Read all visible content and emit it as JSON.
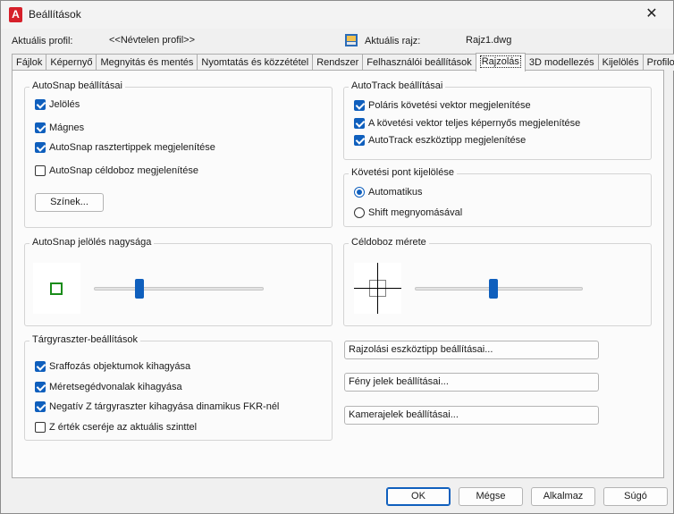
{
  "window": {
    "title": "Beállítások"
  },
  "header": {
    "profile_label": "Aktuális profil:",
    "profile_value": "<<Névtelen profil>>",
    "drawing_label": "Aktuális rajz:",
    "drawing_value": "Rajz1.dwg"
  },
  "tabs": [
    {
      "label": "Fájlok"
    },
    {
      "label": "Képernyő"
    },
    {
      "label": "Megnyitás és mentés"
    },
    {
      "label": "Nyomtatás és közzététel"
    },
    {
      "label": "Rendszer"
    },
    {
      "label": "Felhasználói beállítások"
    },
    {
      "label": "Rajzolás",
      "active": true
    },
    {
      "label": "3D modellezés"
    },
    {
      "label": "Kijelölés"
    },
    {
      "label": "Profilok"
    }
  ],
  "autosnap": {
    "title": "AutoSnap beállításai",
    "items": [
      {
        "label": "Jelölés",
        "checked": true
      },
      {
        "label": "Mágnes",
        "checked": true
      },
      {
        "label": "AutoSnap rasztertippek megjelenítése",
        "checked": true
      },
      {
        "label": "AutoSnap céldoboz megjelenítése",
        "checked": false
      }
    ],
    "colors_button": "Színek..."
  },
  "autotrack": {
    "title": "AutoTrack beállításai",
    "items": [
      {
        "label": "Poláris követési vektor megjelenítése",
        "checked": true
      },
      {
        "label": "A követési vektor teljes képernyős megjelenítése",
        "checked": true
      },
      {
        "label": "AutoTrack eszköztipp megjelenítése",
        "checked": true
      }
    ]
  },
  "tracking_point": {
    "title": "Követési pont kijelölése",
    "options": [
      {
        "label": "Automatikus",
        "selected": true
      },
      {
        "label": "Shift megnyomásával",
        "selected": false
      }
    ]
  },
  "marker_size": {
    "title": "AutoSnap jelölés nagysága",
    "level": 0.27
  },
  "aperture_size": {
    "title": "Céldoboz mérete",
    "level": 0.47
  },
  "object_snap": {
    "title": "Tárgyraszter-beállítások",
    "items": [
      {
        "label": "Sraffozás objektumok kihagyása",
        "checked": true
      },
      {
        "label": "Méretsegédvonalak kihagyása",
        "checked": true
      },
      {
        "label": "Negatív Z tárgyraszter kihagyása dinamikus FKR-nél",
        "checked": true
      },
      {
        "label": "Z érték cseréje az aktuális szinttel",
        "checked": false
      }
    ]
  },
  "side_buttons": {
    "drafting_tooltip": "Rajzolási eszköztipp beállításai...",
    "lights_glyph": "Fény jelek beállításai...",
    "cameras_glyph": "Kamerajelek beállításai..."
  },
  "footer": {
    "ok": "OK",
    "cancel": "Mégse",
    "apply": "Alkalmaz",
    "help": "Súgó"
  },
  "colors": {
    "accent": "#0f5fbd",
    "marker": "#1a8c1a"
  }
}
